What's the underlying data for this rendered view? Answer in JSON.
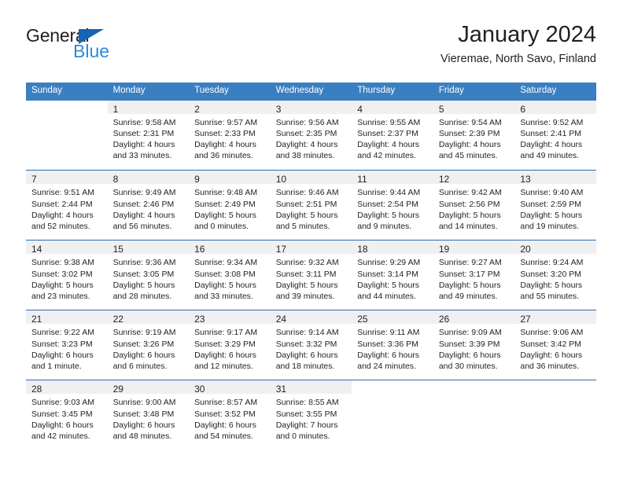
{
  "brand": {
    "name_part1": "General",
    "name_part2": "Blue",
    "triangle_color": "#1565b0",
    "blue_text_color": "#2e8bd6"
  },
  "header": {
    "title": "January 2024",
    "subtitle": "Vieremae, North Savo, Finland"
  },
  "theme": {
    "header_bar_color": "#3a7fc1",
    "row_divider_color": "#2a6dae",
    "daynum_band_color": "#f0f0f0",
    "text_color": "#231f20"
  },
  "columns": [
    "Sunday",
    "Monday",
    "Tuesday",
    "Wednesday",
    "Thursday",
    "Friday",
    "Saturday"
  ],
  "weeks": [
    [
      {
        "day": "",
        "sunrise": "",
        "sunset": "",
        "daylight_line1": "",
        "daylight_line2": ""
      },
      {
        "day": "1",
        "sunrise": "Sunrise: 9:58 AM",
        "sunset": "Sunset: 2:31 PM",
        "daylight_line1": "Daylight: 4 hours",
        "daylight_line2": "and 33 minutes."
      },
      {
        "day": "2",
        "sunrise": "Sunrise: 9:57 AM",
        "sunset": "Sunset: 2:33 PM",
        "daylight_line1": "Daylight: 4 hours",
        "daylight_line2": "and 36 minutes."
      },
      {
        "day": "3",
        "sunrise": "Sunrise: 9:56 AM",
        "sunset": "Sunset: 2:35 PM",
        "daylight_line1": "Daylight: 4 hours",
        "daylight_line2": "and 38 minutes."
      },
      {
        "day": "4",
        "sunrise": "Sunrise: 9:55 AM",
        "sunset": "Sunset: 2:37 PM",
        "daylight_line1": "Daylight: 4 hours",
        "daylight_line2": "and 42 minutes."
      },
      {
        "day": "5",
        "sunrise": "Sunrise: 9:54 AM",
        "sunset": "Sunset: 2:39 PM",
        "daylight_line1": "Daylight: 4 hours",
        "daylight_line2": "and 45 minutes."
      },
      {
        "day": "6",
        "sunrise": "Sunrise: 9:52 AM",
        "sunset": "Sunset: 2:41 PM",
        "daylight_line1": "Daylight: 4 hours",
        "daylight_line2": "and 49 minutes."
      }
    ],
    [
      {
        "day": "7",
        "sunrise": "Sunrise: 9:51 AM",
        "sunset": "Sunset: 2:44 PM",
        "daylight_line1": "Daylight: 4 hours",
        "daylight_line2": "and 52 minutes."
      },
      {
        "day": "8",
        "sunrise": "Sunrise: 9:49 AM",
        "sunset": "Sunset: 2:46 PM",
        "daylight_line1": "Daylight: 4 hours",
        "daylight_line2": "and 56 minutes."
      },
      {
        "day": "9",
        "sunrise": "Sunrise: 9:48 AM",
        "sunset": "Sunset: 2:49 PM",
        "daylight_line1": "Daylight: 5 hours",
        "daylight_line2": "and 0 minutes."
      },
      {
        "day": "10",
        "sunrise": "Sunrise: 9:46 AM",
        "sunset": "Sunset: 2:51 PM",
        "daylight_line1": "Daylight: 5 hours",
        "daylight_line2": "and 5 minutes."
      },
      {
        "day": "11",
        "sunrise": "Sunrise: 9:44 AM",
        "sunset": "Sunset: 2:54 PM",
        "daylight_line1": "Daylight: 5 hours",
        "daylight_line2": "and 9 minutes."
      },
      {
        "day": "12",
        "sunrise": "Sunrise: 9:42 AM",
        "sunset": "Sunset: 2:56 PM",
        "daylight_line1": "Daylight: 5 hours",
        "daylight_line2": "and 14 minutes."
      },
      {
        "day": "13",
        "sunrise": "Sunrise: 9:40 AM",
        "sunset": "Sunset: 2:59 PM",
        "daylight_line1": "Daylight: 5 hours",
        "daylight_line2": "and 19 minutes."
      }
    ],
    [
      {
        "day": "14",
        "sunrise": "Sunrise: 9:38 AM",
        "sunset": "Sunset: 3:02 PM",
        "daylight_line1": "Daylight: 5 hours",
        "daylight_line2": "and 23 minutes."
      },
      {
        "day": "15",
        "sunrise": "Sunrise: 9:36 AM",
        "sunset": "Sunset: 3:05 PM",
        "daylight_line1": "Daylight: 5 hours",
        "daylight_line2": "and 28 minutes."
      },
      {
        "day": "16",
        "sunrise": "Sunrise: 9:34 AM",
        "sunset": "Sunset: 3:08 PM",
        "daylight_line1": "Daylight: 5 hours",
        "daylight_line2": "and 33 minutes."
      },
      {
        "day": "17",
        "sunrise": "Sunrise: 9:32 AM",
        "sunset": "Sunset: 3:11 PM",
        "daylight_line1": "Daylight: 5 hours",
        "daylight_line2": "and 39 minutes."
      },
      {
        "day": "18",
        "sunrise": "Sunrise: 9:29 AM",
        "sunset": "Sunset: 3:14 PM",
        "daylight_line1": "Daylight: 5 hours",
        "daylight_line2": "and 44 minutes."
      },
      {
        "day": "19",
        "sunrise": "Sunrise: 9:27 AM",
        "sunset": "Sunset: 3:17 PM",
        "daylight_line1": "Daylight: 5 hours",
        "daylight_line2": "and 49 minutes."
      },
      {
        "day": "20",
        "sunrise": "Sunrise: 9:24 AM",
        "sunset": "Sunset: 3:20 PM",
        "daylight_line1": "Daylight: 5 hours",
        "daylight_line2": "and 55 minutes."
      }
    ],
    [
      {
        "day": "21",
        "sunrise": "Sunrise: 9:22 AM",
        "sunset": "Sunset: 3:23 PM",
        "daylight_line1": "Daylight: 6 hours",
        "daylight_line2": "and 1 minute."
      },
      {
        "day": "22",
        "sunrise": "Sunrise: 9:19 AM",
        "sunset": "Sunset: 3:26 PM",
        "daylight_line1": "Daylight: 6 hours",
        "daylight_line2": "and 6 minutes."
      },
      {
        "day": "23",
        "sunrise": "Sunrise: 9:17 AM",
        "sunset": "Sunset: 3:29 PM",
        "daylight_line1": "Daylight: 6 hours",
        "daylight_line2": "and 12 minutes."
      },
      {
        "day": "24",
        "sunrise": "Sunrise: 9:14 AM",
        "sunset": "Sunset: 3:32 PM",
        "daylight_line1": "Daylight: 6 hours",
        "daylight_line2": "and 18 minutes."
      },
      {
        "day": "25",
        "sunrise": "Sunrise: 9:11 AM",
        "sunset": "Sunset: 3:36 PM",
        "daylight_line1": "Daylight: 6 hours",
        "daylight_line2": "and 24 minutes."
      },
      {
        "day": "26",
        "sunrise": "Sunrise: 9:09 AM",
        "sunset": "Sunset: 3:39 PM",
        "daylight_line1": "Daylight: 6 hours",
        "daylight_line2": "and 30 minutes."
      },
      {
        "day": "27",
        "sunrise": "Sunrise: 9:06 AM",
        "sunset": "Sunset: 3:42 PM",
        "daylight_line1": "Daylight: 6 hours",
        "daylight_line2": "and 36 minutes."
      }
    ],
    [
      {
        "day": "28",
        "sunrise": "Sunrise: 9:03 AM",
        "sunset": "Sunset: 3:45 PM",
        "daylight_line1": "Daylight: 6 hours",
        "daylight_line2": "and 42 minutes."
      },
      {
        "day": "29",
        "sunrise": "Sunrise: 9:00 AM",
        "sunset": "Sunset: 3:48 PM",
        "daylight_line1": "Daylight: 6 hours",
        "daylight_line2": "and 48 minutes."
      },
      {
        "day": "30",
        "sunrise": "Sunrise: 8:57 AM",
        "sunset": "Sunset: 3:52 PM",
        "daylight_line1": "Daylight: 6 hours",
        "daylight_line2": "and 54 minutes."
      },
      {
        "day": "31",
        "sunrise": "Sunrise: 8:55 AM",
        "sunset": "Sunset: 3:55 PM",
        "daylight_line1": "Daylight: 7 hours",
        "daylight_line2": "and 0 minutes."
      },
      {
        "day": "",
        "sunrise": "",
        "sunset": "",
        "daylight_line1": "",
        "daylight_line2": ""
      },
      {
        "day": "",
        "sunrise": "",
        "sunset": "",
        "daylight_line1": "",
        "daylight_line2": ""
      },
      {
        "day": "",
        "sunrise": "",
        "sunset": "",
        "daylight_line1": "",
        "daylight_line2": ""
      }
    ]
  ]
}
